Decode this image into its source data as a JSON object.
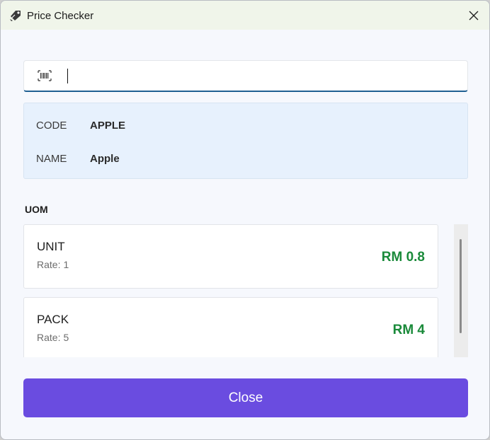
{
  "window": {
    "title": "Price Checker",
    "app_icon": "price-tag-icon",
    "close_icon": "close-icon"
  },
  "search": {
    "icon": "barcode-icon",
    "value": "",
    "placeholder": ""
  },
  "product": {
    "code_label": "CODE",
    "code_value": "APPLE",
    "name_label": "NAME",
    "name_value": "Apple"
  },
  "uom": {
    "heading": "UOM",
    "rate_label": "Rate:",
    "items": [
      {
        "name": "UNIT",
        "rate": "1",
        "price": "RM 0.8"
      },
      {
        "name": "PACK",
        "rate": "5",
        "price": "RM 4"
      }
    ]
  },
  "footer": {
    "close_label": "Close"
  },
  "colors": {
    "accent": "#6a4ce0",
    "price": "#1a8a3a",
    "info_bg": "#e7f1fd",
    "input_underline": "#1f5f92"
  }
}
